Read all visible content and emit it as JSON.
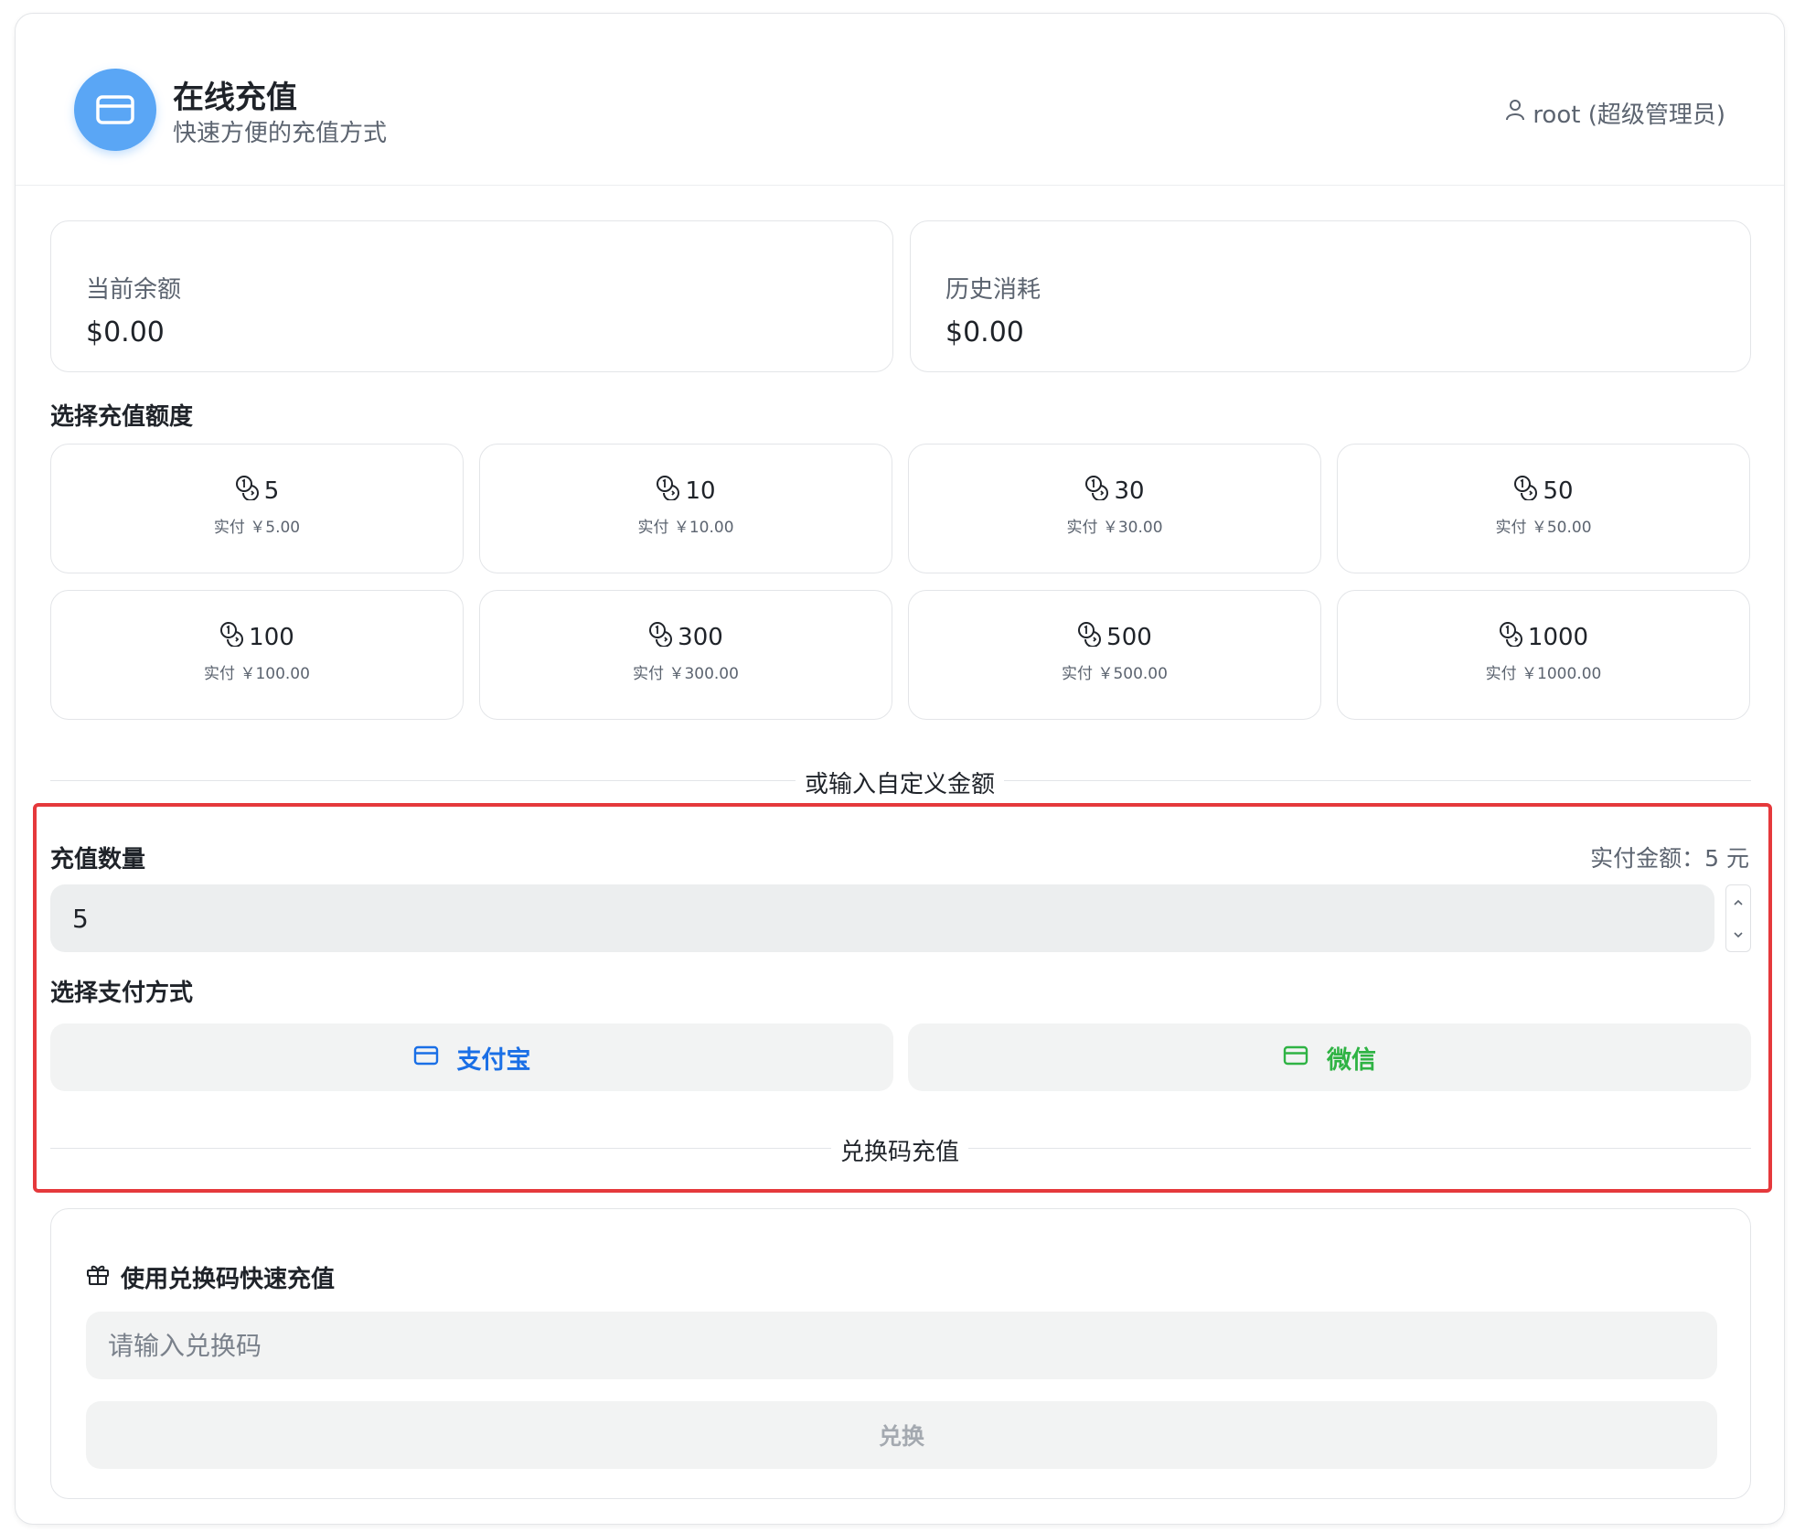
{
  "header": {
    "title": "在线充值",
    "subtitle": "快速方便的充值方式",
    "user": "root (超级管理员)"
  },
  "stats": {
    "balance_label": "当前余额",
    "balance_value": "$0.00",
    "history_label": "历史消耗",
    "history_value": "$0.00"
  },
  "amounts": {
    "section_title": "选择充值额度",
    "items": [
      {
        "value": "5",
        "pay": "实付 ￥5.00"
      },
      {
        "value": "10",
        "pay": "实付 ￥10.00"
      },
      {
        "value": "30",
        "pay": "实付 ￥30.00"
      },
      {
        "value": "50",
        "pay": "实付 ￥50.00"
      },
      {
        "value": "100",
        "pay": "实付 ￥100.00"
      },
      {
        "value": "300",
        "pay": "实付 ￥300.00"
      },
      {
        "value": "500",
        "pay": "实付 ￥500.00"
      },
      {
        "value": "1000",
        "pay": "实付 ￥1000.00"
      }
    ]
  },
  "custom": {
    "divider_text": "或输入自定义金额",
    "quantity_label": "充值数量",
    "pay_amount": "实付金额：5 元",
    "quantity_value": "5"
  },
  "payment": {
    "title": "选择支付方式",
    "alipay": "支付宝",
    "wechat": "微信",
    "alipay_color": "#1a6fe6",
    "wechat_color": "#2fb344"
  },
  "redeem": {
    "divider_text": "兑换码充值",
    "title": "使用兑换码快速充值",
    "placeholder": "请输入兑换码",
    "button": "兑换"
  },
  "colors": {
    "accent": "#5aa6f5",
    "highlight_border": "#e5393c"
  }
}
